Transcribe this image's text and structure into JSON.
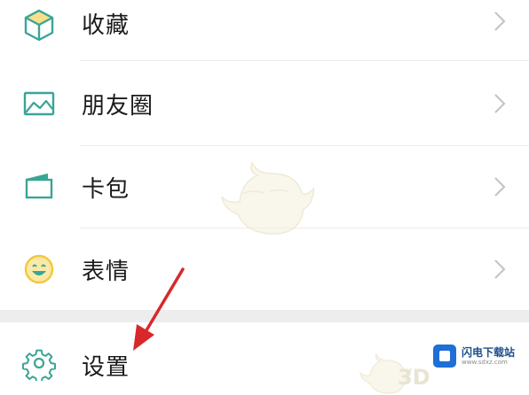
{
  "menu": {
    "items": [
      {
        "label": "收藏",
        "icon": "cube-favorites-icon"
      },
      {
        "label": "朋友圈",
        "icon": "landscape-moments-icon"
      },
      {
        "label": "卡包",
        "icon": "wallet-cards-icon"
      },
      {
        "label": "表情",
        "icon": "smiley-stickers-icon"
      }
    ],
    "settings": {
      "label": "设置",
      "icon": "gear-icon"
    }
  },
  "annotation": {
    "arrow_color": "#d8282a"
  },
  "watermark": {
    "brand_name": "闪电下载站",
    "brand_url": "www.sdxz.com",
    "brand_color": "#1e6fd6",
    "mark_3d": "3D"
  },
  "colors": {
    "icon_teal": "#3aa596",
    "icon_yellow": "#f2c740",
    "chevron": "#c2c2c2"
  }
}
